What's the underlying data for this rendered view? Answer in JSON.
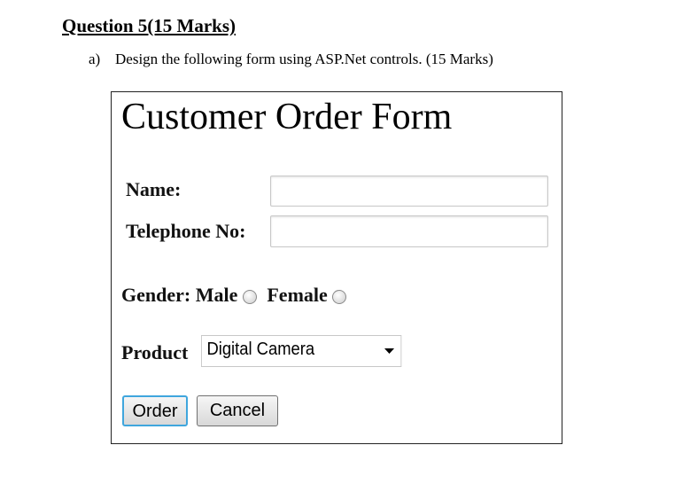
{
  "question": {
    "title": "Question 5(15 Marks)",
    "part_label": "a)",
    "part_text": "Design the following form using ASP.Net controls. (15 Marks)"
  },
  "form": {
    "title": "Customer Order Form",
    "name_label": "Name:",
    "name_value": "",
    "phone_label": "Telephone No:",
    "phone_value": "",
    "gender_label": "Gender:",
    "male_label": "Male",
    "female_label": "Female",
    "product_label": "Product",
    "product_selected": "Digital Camera",
    "order_label": "Order",
    "cancel_label": "Cancel"
  }
}
